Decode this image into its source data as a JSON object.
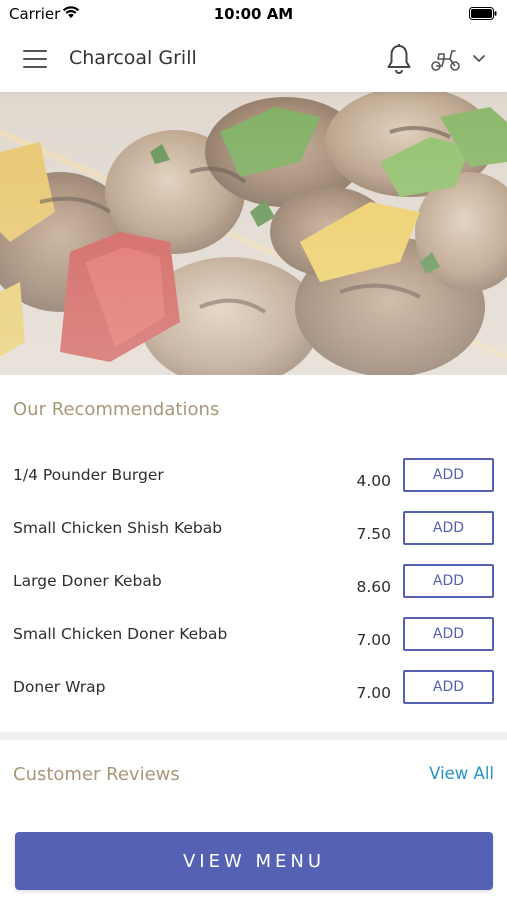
{
  "status_bar": {
    "carrier": "Carrier",
    "time": "10:00 AM"
  },
  "app_bar": {
    "title": "Charcoal Grill",
    "icons": [
      "menu-icon",
      "bell-icon",
      "scooter-icon",
      "chevron-down-icon"
    ]
  },
  "hero": {
    "image": "grilled-kebab-skewers-photo"
  },
  "recommendations": {
    "title": "Our Recommendations",
    "items": [
      {
        "name": "1/4 Pounder Burger",
        "price": "4.00",
        "button": "ADD"
      },
      {
        "name": "Small Chicken Shish Kebab",
        "price": "7.50",
        "button": "ADD"
      },
      {
        "name": "Large Doner Kebab",
        "price": "8.60",
        "button": "ADD"
      },
      {
        "name": "Small Chicken Doner Kebab",
        "price": "7.00",
        "button": "ADD"
      },
      {
        "name": "Doner Wrap",
        "price": "7.00",
        "button": "ADD"
      }
    ]
  },
  "reviews": {
    "title": "Customer Reviews",
    "view_all": "View All"
  },
  "footer": {
    "view_menu": "VIEW MENU"
  },
  "colors": {
    "accent": "#5562b3",
    "section_title": "#a8977a",
    "link": "#2a93c4"
  }
}
